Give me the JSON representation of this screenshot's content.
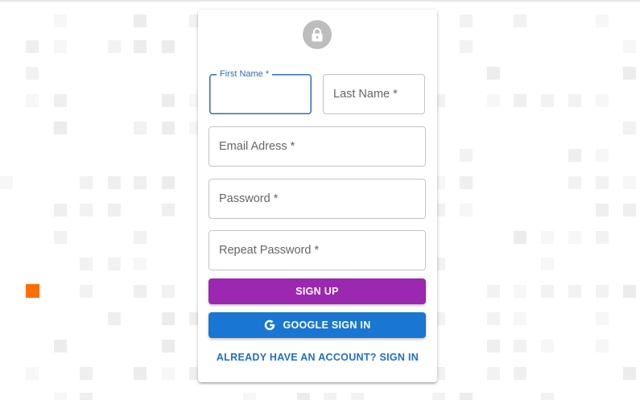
{
  "form": {
    "first_name": {
      "label": "First Name *",
      "value": ""
    },
    "last_name": {
      "label": "Last Name *",
      "value": ""
    },
    "email": {
      "label": "Email Adress *",
      "value": ""
    },
    "password": {
      "label": "Password *",
      "value": ""
    },
    "repeat_password": {
      "label": "Repeat Password *",
      "value": ""
    }
  },
  "buttons": {
    "sign_up": "SIGN UP",
    "google_sign_in": "GOOGLE SIGN IN",
    "signin_link": "ALREADY HAVE AN ACCOUNT? SIGN IN"
  },
  "icons": {
    "avatar": "lock-icon",
    "google": "google-g-icon"
  },
  "colors": {
    "sign_up_button": "#9c27b0",
    "google_button": "#1976d2",
    "focus_accent": "#2f6db8",
    "link": "#1e6fc9",
    "avatar_bg": "#bdbdbd",
    "pattern_accent": "#ff6f00"
  }
}
